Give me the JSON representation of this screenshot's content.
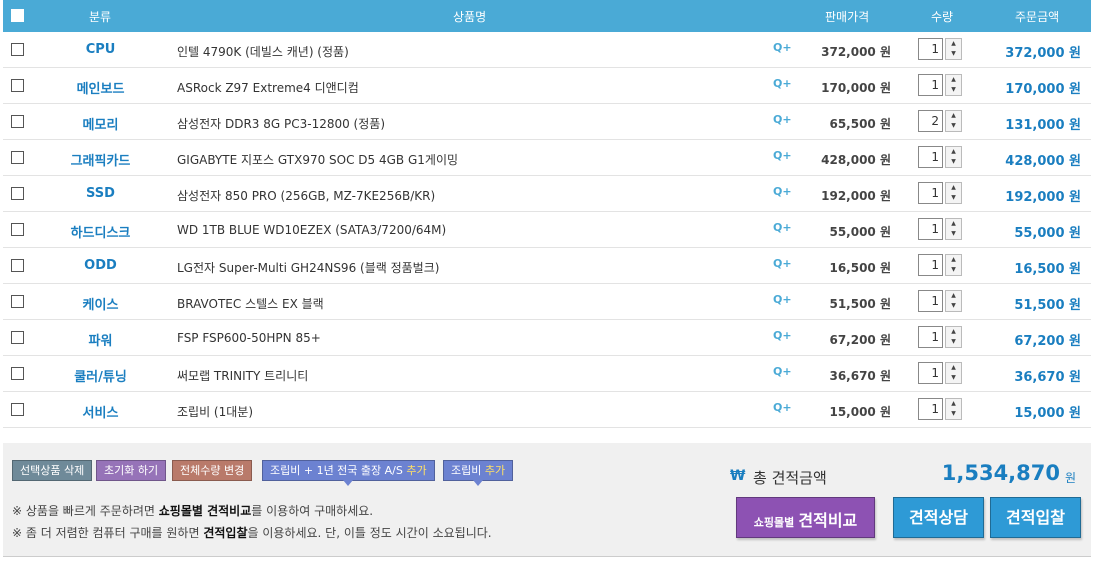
{
  "header": {
    "category": "분류",
    "product": "상품명",
    "price": "판매가격",
    "qty": "수량",
    "total": "주문금액"
  },
  "zoom_label": "Q+",
  "rows": [
    {
      "cat": "CPU",
      "name": "인텔 4790K (데빌스 캐년) (정품)",
      "price": "372,000 원",
      "qty": "1",
      "total": "372,000 원"
    },
    {
      "cat": "메인보드",
      "name": "ASRock Z97 Extreme4 디앤디컴",
      "price": "170,000 원",
      "qty": "1",
      "total": "170,000 원"
    },
    {
      "cat": "메모리",
      "name": "삼성전자 DDR3 8G PC3-12800 (정품)",
      "price": "65,500 원",
      "qty": "2",
      "total": "131,000 원"
    },
    {
      "cat": "그래픽카드",
      "name": "GIGABYTE 지포스 GTX970 SOC D5 4GB G1게이밍",
      "price": "428,000 원",
      "qty": "1",
      "total": "428,000 원"
    },
    {
      "cat": "SSD",
      "name": "삼성전자 850 PRO (256GB, MZ-7KE256B/KR)",
      "price": "192,000 원",
      "qty": "1",
      "total": "192,000 원"
    },
    {
      "cat": "하드디스크",
      "name": "WD 1TB BLUE WD10EZEX (SATA3/7200/64M)",
      "price": "55,000 원",
      "qty": "1",
      "total": "55,000 원"
    },
    {
      "cat": "ODD",
      "name": "LG전자 Super-Multi GH24NS96 (블랙 정품벌크)",
      "price": "16,500 원",
      "qty": "1",
      "total": "16,500 원"
    },
    {
      "cat": "케이스",
      "name": "BRAVOTEC 스텔스 EX 블랙",
      "price": "51,500 원",
      "qty": "1",
      "total": "51,500 원"
    },
    {
      "cat": "파워",
      "name": "FSP FSP600-50HPN 85+",
      "price": "67,200 원",
      "qty": "1",
      "total": "67,200 원"
    },
    {
      "cat": "쿨러/튜닝",
      "name": "써모랩 TRINITY 트리니티",
      "price": "36,670 원",
      "qty": "1",
      "total": "36,670 원"
    },
    {
      "cat": "서비스",
      "name": "조립비 (1대분)",
      "price": "15,000 원",
      "qty": "1",
      "total": "15,000 원"
    }
  ],
  "footer": {
    "btn_delete": "선택상품 삭제",
    "btn_reset": "초기화 하기",
    "btn_qty": "전체수량 변경",
    "btn_asm1_text": "조립비 + 1년 전국 출장 A/S ",
    "btn_asm1_hl": "추가",
    "btn_asm2_text": "조립비 ",
    "btn_asm2_hl": "추가",
    "note1_a": "※ 상품을 빠르게 주문하려면 ",
    "note1_b": "쇼핑몰별 견적비교",
    "note1_c": "를 이용하여 구매하세요.",
    "note2_a": "※ 좀 더 저렴한 컴퓨터 구매를 원하면 ",
    "note2_b": "견적입찰",
    "note2_c": "을 이용하세요. 단, 이틀 정도 시간이 소요됩니다.",
    "won_symbol": "₩",
    "est_label": "총 견적금액",
    "est_amount": "1,534,870",
    "est_unit": "원",
    "btn_compare_small": "쇼핑몰별",
    "btn_compare_large": "견적비교",
    "btn_consult": "견적상담",
    "btn_bid": "견적입찰"
  }
}
